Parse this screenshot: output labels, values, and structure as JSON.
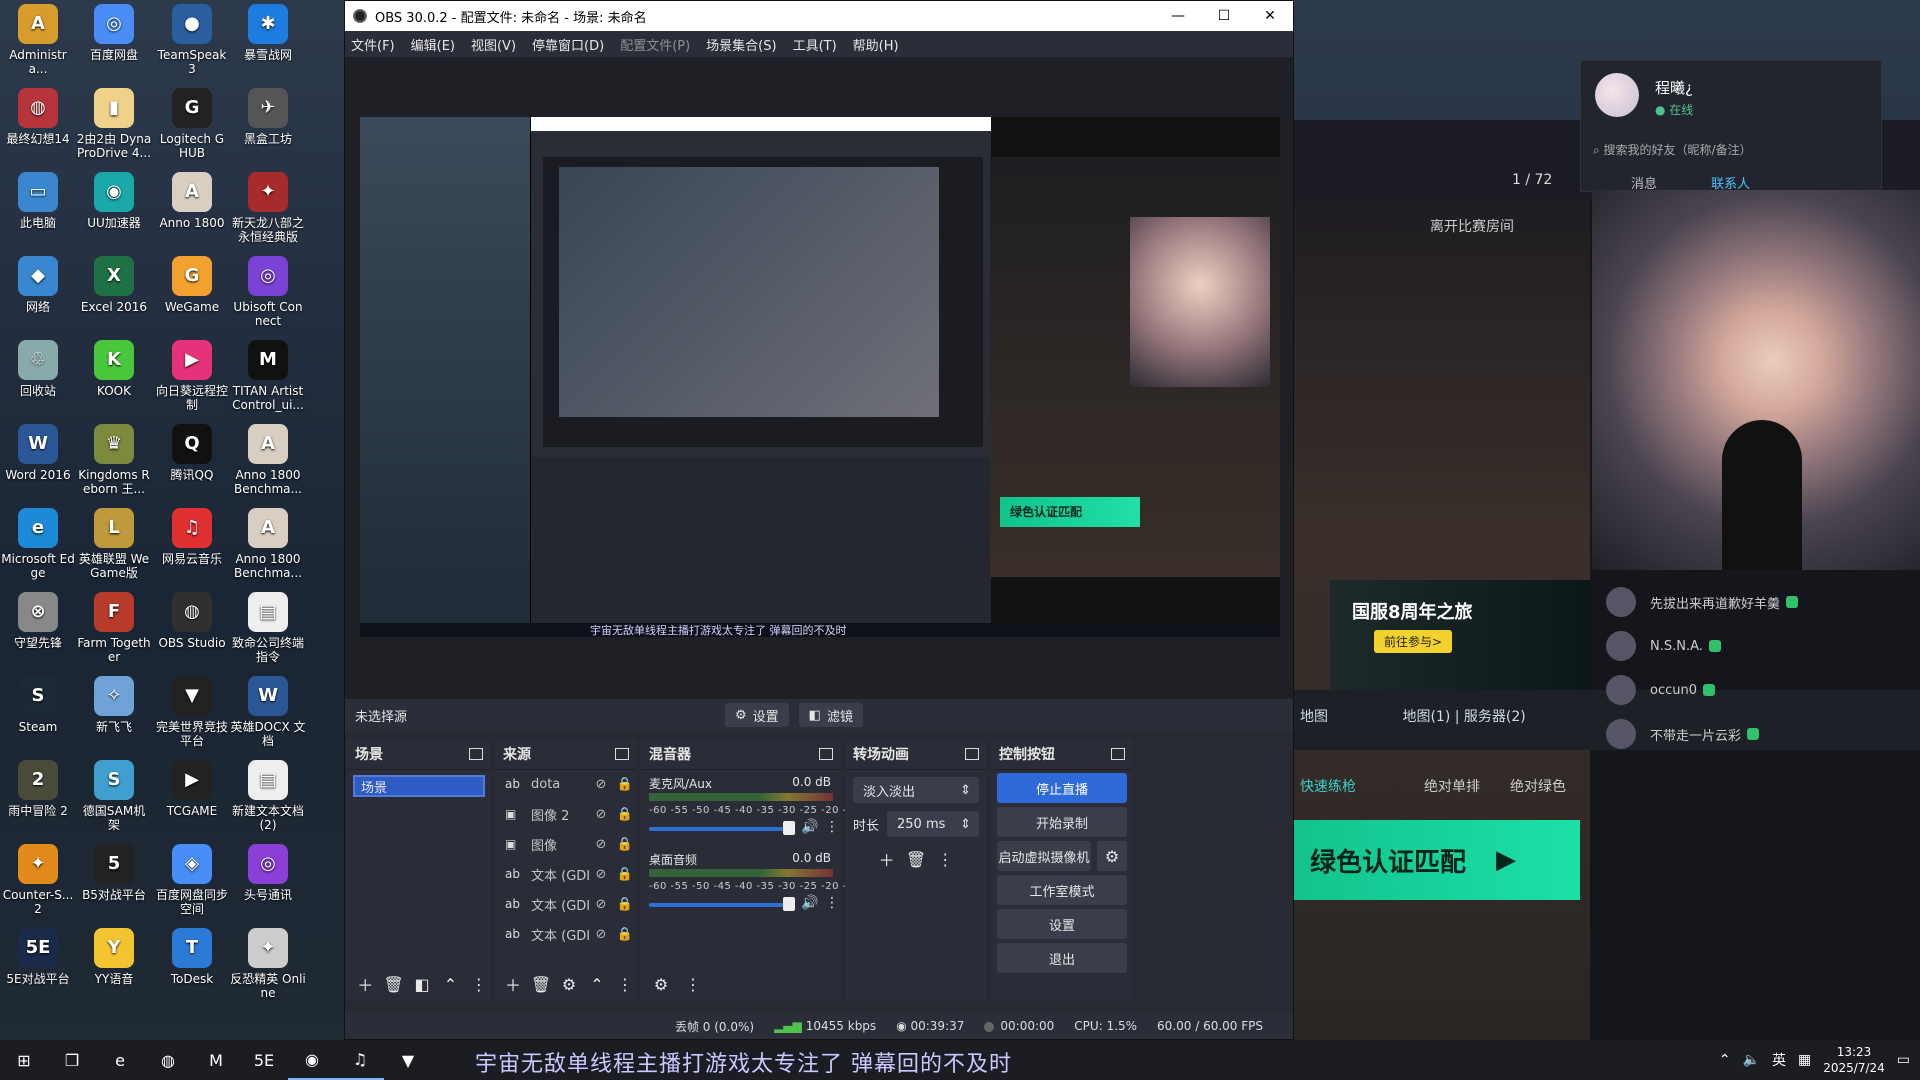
{
  "desktop_icons": [
    {
      "label": "Administra...",
      "color": "#d79c2b",
      "glyph": "A"
    },
    {
      "label": "百度网盘",
      "color": "#4a8df7",
      "glyph": "◎"
    },
    {
      "label": "TeamSpeak 3",
      "color": "#2b5e9e",
      "glyph": "●"
    },
    {
      "label": "暴雪战网",
      "color": "#1d7ce0",
      "glyph": "✱"
    },
    {
      "label": "最终幻想14",
      "color": "#b8343b",
      "glyph": "◍"
    },
    {
      "label": "2由2由 Dyna ProDrive 4...",
      "color": "#f0d18a",
      "glyph": "▮"
    },
    {
      "label": "Logitech G HUB",
      "color": "#222",
      "glyph": "G"
    },
    {
      "label": "黑盒工坊",
      "color": "#555",
      "glyph": "✈"
    },
    {
      "label": "此电脑",
      "color": "#3a87d0",
      "glyph": "▭"
    },
    {
      "label": "UU加速器",
      "color": "#1aa8a8",
      "glyph": "◉"
    },
    {
      "label": "Anno 1800",
      "color": "#d8cfc2",
      "glyph": "A"
    },
    {
      "label": "新天龙八部之 永恒经典版",
      "color": "#a82b2b",
      "glyph": "✦"
    },
    {
      "label": "网络",
      "color": "#3a87d0",
      "glyph": "◆"
    },
    {
      "label": "Excel 2016",
      "color": "#1e7145",
      "glyph": "X"
    },
    {
      "label": "WeGame",
      "color": "#f2a12e",
      "glyph": "G"
    },
    {
      "label": "Ubisoft Connect",
      "color": "#7a43d6",
      "glyph": "◎"
    },
    {
      "label": "回收站",
      "color": "#8aa",
      "glyph": "♲"
    },
    {
      "label": "KOOK",
      "color": "#49c73b",
      "glyph": "K"
    },
    {
      "label": "向日葵远程控 制",
      "color": "#e6327a",
      "glyph": "▶"
    },
    {
      "label": "TITAN Artist Control_ui...",
      "color": "#111",
      "glyph": "M"
    },
    {
      "label": "Word 2016",
      "color": "#2b5797",
      "glyph": "W"
    },
    {
      "label": "Kingdoms Reborn 王...",
      "color": "#7b8a3c",
      "glyph": "♛"
    },
    {
      "label": "腾讯QQ",
      "color": "#111",
      "glyph": "Q"
    },
    {
      "label": "Anno 1800 Benchma...",
      "color": "#d8cfc2",
      "glyph": "A"
    },
    {
      "label": "Microsoft Edge",
      "color": "#1c8ad6",
      "glyph": "e"
    },
    {
      "label": "英雄联盟 WeGame版",
      "color": "#bf9a3c",
      "glyph": "L"
    },
    {
      "label": "网易云音乐",
      "color": "#e03030",
      "glyph": "♫"
    },
    {
      "label": "Anno 1800 Benchma...",
      "color": "#d8cfc2",
      "glyph": "A"
    },
    {
      "label": "守望先锋",
      "color": "#888",
      "glyph": "⊗"
    },
    {
      "label": "Farm Together",
      "color": "#b83a2b",
      "glyph": "F"
    },
    {
      "label": "OBS Studio",
      "color": "#303030",
      "glyph": "◍"
    },
    {
      "label": "致命公司终端 指令",
      "color": "#eee",
      "glyph": "▤"
    },
    {
      "label": "Steam",
      "color": "#1b2838",
      "glyph": "S"
    },
    {
      "label": "新飞飞",
      "color": "#6fa3d8",
      "glyph": "✧"
    },
    {
      "label": "完美世界竞技 平台",
      "color": "#222",
      "glyph": "▼"
    },
    {
      "label": "英雄DOCX 文档",
      "color": "#2b5797",
      "glyph": "W"
    },
    {
      "label": "雨中冒险 2",
      "color": "#4a4a3a",
      "glyph": "2"
    },
    {
      "label": "德国SAM机 架",
      "color": "#3fa0d0",
      "glyph": "S"
    },
    {
      "label": "TCGAME",
      "color": "#222",
      "glyph": "▶"
    },
    {
      "label": "新建文本文档 (2)",
      "color": "#eee",
      "glyph": "▤"
    },
    {
      "label": "Counter-S... 2",
      "color": "#e28b1c",
      "glyph": "✦"
    },
    {
      "label": "B5对战平台",
      "color": "#222",
      "glyph": "5"
    },
    {
      "label": "百度网盘同步 空间",
      "color": "#4a8df7",
      "glyph": "◈"
    },
    {
      "label": "头号通讯",
      "color": "#8b3fd6",
      "glyph": "◎"
    },
    {
      "label": "5E对战平台",
      "color": "#1c2a4a",
      "glyph": "5E"
    },
    {
      "label": "YY语音",
      "color": "#f4c430",
      "glyph": "Y"
    },
    {
      "label": "ToDesk",
      "color": "#2b7bd6",
      "glyph": "T"
    },
    {
      "label": "反恐精英 Online",
      "color": "#ccc",
      "glyph": "✦"
    }
  ],
  "obs": {
    "title": "OBS 30.0.2 - 配置文件: 未命名 - 场景: 未命名",
    "menus": [
      "文件(F)",
      "编辑(E)",
      "视图(V)",
      "停靠窗口(D)",
      "配置文件(P)",
      "场景集合(S)",
      "工具(T)",
      "帮助(H)"
    ],
    "minimize": "—",
    "maximize": "☐",
    "close": "✕",
    "preview_subtitle": "宇宙无敌单线程主播打游戏太专注了 弹幕回的不及时",
    "preview_green": "绿色认证匹配",
    "no_source": "未选择源",
    "settings_btn": "设置",
    "filters_btn": "滤镜",
    "scenes": {
      "title": "场景",
      "items": [
        "场景"
      ]
    },
    "sources": {
      "title": "来源",
      "items": [
        {
          "icon": "ab",
          "name": "dota"
        },
        {
          "icon": "▣",
          "name": "图像 2"
        },
        {
          "icon": "▣",
          "name": "图像"
        },
        {
          "icon": "ab",
          "name": "文本 (GDI+"
        },
        {
          "icon": "ab",
          "name": "文本 (GDI+"
        },
        {
          "icon": "ab",
          "name": "文本 (GDI+"
        }
      ]
    },
    "mixer": {
      "title": "混音器",
      "channels": [
        {
          "name": "麦克风/Aux",
          "db": "0.0 dB",
          "level": 0.0
        },
        {
          "name": "桌面音频",
          "db": "0.0 dB",
          "level": 0.0
        }
      ],
      "ticks": "-60 -55 -50 -45 -40 -35 -30 -25 -20 -15 -10 -5 0"
    },
    "transitions": {
      "title": "转场动画",
      "type": "淡入淡出",
      "duration_label": "时长",
      "duration": "250 ms"
    },
    "controls": {
      "title": "控制按钮",
      "stop_stream": "停止直播",
      "start_record": "开始录制",
      "virtual_cam": "启动虚拟摄像机",
      "studio_mode": "工作室模式",
      "settings": "设置",
      "exit": "退出"
    },
    "status": {
      "dropped": "丢帧 0 (0.0%)",
      "bitrate": "10455 kbps",
      "stream_time": "00:39:37",
      "record_time": "00:00:00",
      "cpu": "CPU: 1.5%",
      "fps": "60.00 / 60.00 FPS"
    }
  },
  "background": {
    "friend_name": "程曦¿",
    "friend_status": "● 在线",
    "friend_search": "搜索我的好友（昵称/备注）",
    "tab_messages": "消息",
    "tab_contacts": "联系人",
    "counter": "1 / 72",
    "leave_room": "离开比赛房间",
    "map_select": "地图(1) | 服务器(2)",
    "map_label": "地图",
    "quick_train": "快速练枪",
    "absolute_single": "绝对单排",
    "absolute_green": "绝对绿色",
    "green_cta": "绿色认证匹配",
    "green_tag": "绿色",
    "banner_title": "国服8周年之旅",
    "banner_btn": "前往参与>",
    "chat": [
      {
        "name": "先拔出来再道歉好羊羹"
      },
      {
        "name": "N.S.N.A."
      },
      {
        "name": "occun0"
      },
      {
        "name": "不带走一片云彩"
      }
    ]
  },
  "taskbar": {
    "subtitle": "宇宙无敌单线程主播打游戏太专注了 弹幕回的不及时",
    "time": "13:23",
    "date": "2025/7/24",
    "lang": "英",
    "apps": [
      "windows-start",
      "task-view",
      "edge",
      "steam",
      "titan",
      "5e",
      "obs",
      "netease-music",
      "csgo"
    ]
  },
  "colors": {
    "accent": "#2f6bd8",
    "obs_bg": "#272a33",
    "green_cta": "#1de0a9"
  }
}
